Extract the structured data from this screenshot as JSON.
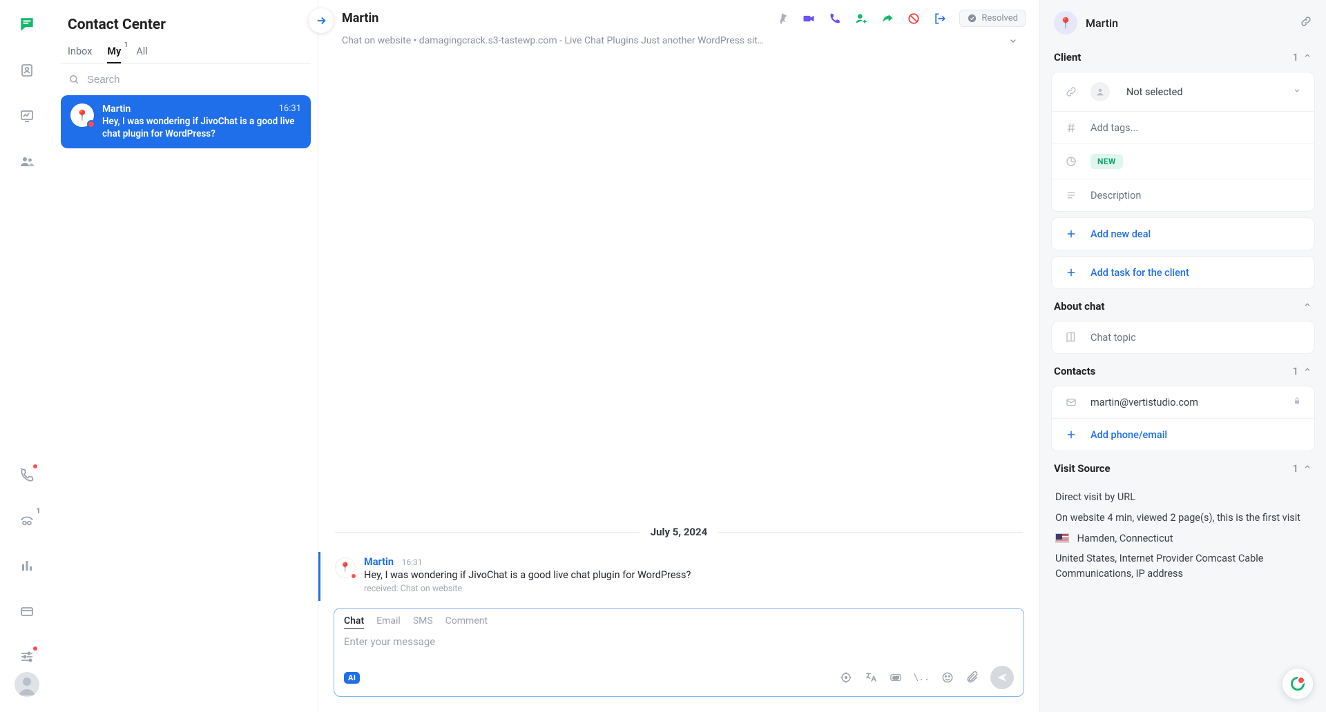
{
  "app": {
    "title": "Contact Center"
  },
  "tabs": {
    "inbox": "Inbox",
    "my": "My",
    "my_badge": "1",
    "all": "All"
  },
  "search": {
    "placeholder": "Search"
  },
  "conversations": [
    {
      "name": "Martin",
      "time": "16:31",
      "preview": "Hey, I was wondering if JivoChat is a good live chat plugin for WordPress?"
    }
  ],
  "chat": {
    "title": "Martin",
    "resolved_label": "Resolved",
    "subheader": "Chat on website • damagingcrack.s3-tastewp.com - Live Chat Plugins Just another WordPress sit…",
    "date": "July 5, 2024",
    "message": {
      "name": "Martin",
      "time": "16:31",
      "text": "Hey, I was wondering if JivoChat is a good live chat plugin for WordPress?",
      "meta": "received: Chat on website"
    }
  },
  "composer": {
    "tabs": {
      "chat": "Chat",
      "email": "Email",
      "sms": "SMS",
      "comment": "Comment"
    },
    "placeholder": "Enter your message",
    "ai_label": "AI",
    "slash": "\\.."
  },
  "client": {
    "name": "Martin",
    "sections": {
      "client": {
        "title": "Client",
        "count": "1"
      },
      "about": {
        "title": "About chat"
      },
      "contacts": {
        "title": "Contacts",
        "count": "1"
      },
      "visit": {
        "title": "Visit Source",
        "count": "1"
      }
    },
    "assignee": "Not selected",
    "tags_placeholder": "Add tags...",
    "status_chip": "NEW",
    "description_placeholder": "Description",
    "add_deal": "Add new deal",
    "add_task": "Add task for the client",
    "chat_topic_placeholder": "Chat topic",
    "email": "martin@vertistudio.com",
    "add_phone_email": "Add phone/email",
    "visit": {
      "line1": "Direct visit by URL",
      "line2": "On website 4 min, viewed 2 page(s), this is the first visit",
      "location": "Hamden, Connecticut",
      "details": "United States, Internet Provider Comcast Cable Communications, IP address"
    }
  }
}
